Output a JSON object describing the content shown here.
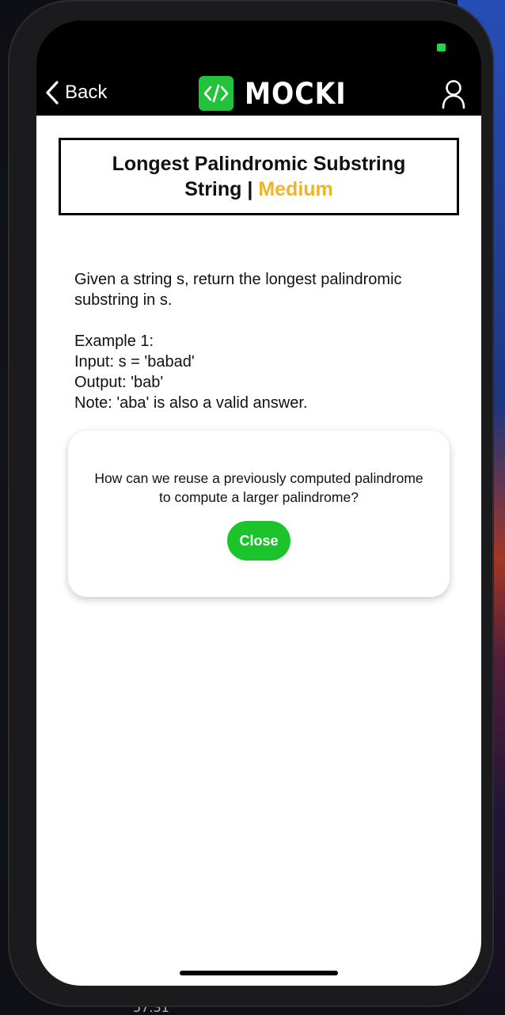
{
  "app": {
    "brand_name": "MOCKI",
    "brand_color": "#22c23a"
  },
  "nav": {
    "back_label": "Back"
  },
  "problem": {
    "title": "Longest Palindromic Substring",
    "category": "String",
    "separator": "|",
    "difficulty": "Medium",
    "difficulty_color": "#f0b429",
    "description": "Given a string s, return the longest palindromic substring in s.",
    "example_heading": "Example 1:",
    "example_input": "Input: s = 'babad'",
    "example_output": "Output: 'bab'",
    "example_note": "Note: 'aba' is also a valid answer."
  },
  "hint_modal": {
    "text": "How can we reuse a previously computed palindrome to compute a larger palindrome?",
    "close_label": "Close",
    "close_color": "#1bc42b"
  },
  "desktop": {
    "time_fragment": "57.31"
  },
  "icons": {
    "back": "chevron-left-icon",
    "logo": "code-brackets-icon",
    "user": "user-icon"
  }
}
